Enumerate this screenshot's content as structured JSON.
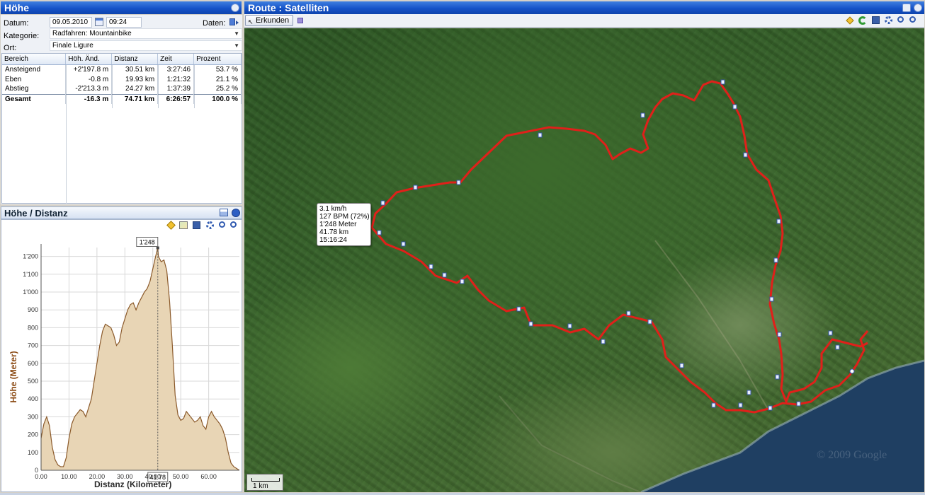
{
  "left_panel": {
    "title": "Höhe",
    "datum_label": "Datum:",
    "datum_value": "09.05.2010",
    "time_value": "09:24",
    "daten_label": "Daten:",
    "kategorie_label": "Kategorie:",
    "kategorie_value": "Radfahren: Mountainbike",
    "ort_label": "Ort:",
    "ort_value": "Finale Ligure",
    "columns": [
      "Bereich",
      "Höh. Änd.",
      "Distanz",
      "Zeit",
      "Prozent"
    ],
    "rows": [
      [
        "Ansteigend",
        "+2'197.8 m",
        "30.51 km",
        "3:27:46",
        "53.7 %"
      ],
      [
        "Eben",
        "-0.8 m",
        "19.93 km",
        "1:21:32",
        "21.1 %"
      ],
      [
        "Abstieg",
        "-2'213.3 m",
        "24.27 km",
        "1:37:39",
        "25.2 %"
      ]
    ],
    "total": [
      "Gesamt",
      "-16.3 m",
      "74.71 km",
      "6:26:57",
      "100.0 %"
    ]
  },
  "chart_panel": {
    "title": "Höhe / Distanz"
  },
  "chart_data": {
    "type": "area",
    "xlabel": "Distanz (Kilometer)",
    "ylabel": "Höhe (Meter)",
    "xlim": [
      0,
      71
    ],
    "ylim": [
      0,
      1250
    ],
    "x_ticks": [
      "0.00",
      "10.00",
      "20.00",
      "30.00",
      "40.00",
      "50.00",
      "60.00"
    ],
    "y_ticks": [
      "0",
      "100",
      "200",
      "300",
      "400",
      "500",
      "600",
      "700",
      "800",
      "900",
      "1'000",
      "1'100",
      "1'200"
    ],
    "x_tick_values": [
      0,
      10,
      20,
      30,
      40,
      50,
      60
    ],
    "y_tick_values": [
      0,
      100,
      200,
      300,
      400,
      500,
      600,
      700,
      800,
      900,
      1000,
      1100,
      1200
    ],
    "marker_x_label": "41.78",
    "marker_y_label": "1'248",
    "marker": [
      41.78,
      1248
    ],
    "fill_color": "#e8d5b5",
    "line_color": "#8b5a2b",
    "series": [
      {
        "x": [
          0,
          1,
          2,
          3,
          4,
          5,
          6,
          7,
          8,
          9,
          10,
          11,
          12,
          13,
          14,
          15,
          16,
          17,
          18,
          19,
          20,
          21,
          22,
          23,
          24,
          25,
          26,
          27,
          28,
          29,
          30,
          31,
          32,
          33,
          34,
          35,
          36,
          37,
          38,
          39,
          40,
          41,
          41.78,
          42,
          43,
          44,
          45,
          46,
          47,
          48,
          49,
          50,
          51,
          52,
          53,
          54,
          55,
          56,
          57,
          58,
          59,
          60,
          61,
          62,
          63,
          64,
          65,
          66,
          67,
          68,
          69,
          70,
          71
        ],
        "y": [
          180,
          260,
          300,
          250,
          130,
          60,
          30,
          20,
          20,
          70,
          180,
          260,
          300,
          320,
          340,
          330,
          300,
          350,
          400,
          500,
          600,
          700,
          780,
          820,
          810,
          800,
          760,
          700,
          720,
          800,
          850,
          900,
          930,
          940,
          900,
          940,
          970,
          1000,
          1020,
          1060,
          1130,
          1200,
          1248,
          1200,
          1170,
          1180,
          1120,
          950,
          700,
          420,
          310,
          280,
          290,
          330,
          310,
          290,
          270,
          280,
          300,
          250,
          230,
          300,
          330,
          300,
          280,
          260,
          230,
          180,
          100,
          40,
          20,
          10,
          0
        ]
      }
    ]
  },
  "map_panel": {
    "title": "Route : Satelliten",
    "explore_button": "Erkunden",
    "scale_label": "1 km",
    "copyright": "© 2009 Google",
    "route_color": "#e0201a",
    "tooltip_lines": [
      "3.1 km/h",
      "127 BPM (72%)",
      "1'248 Meter",
      "41.78 km",
      "15:16:24"
    ]
  },
  "icons": {
    "calendar": "calendar-icon",
    "data": "data-import-icon",
    "refresh": "refresh-icon",
    "save": "save-icon",
    "settings": "gear-icon",
    "zoom_in": "zoom-in-icon",
    "zoom_out": "zoom-out-icon",
    "diamond": "diamond-icon"
  }
}
